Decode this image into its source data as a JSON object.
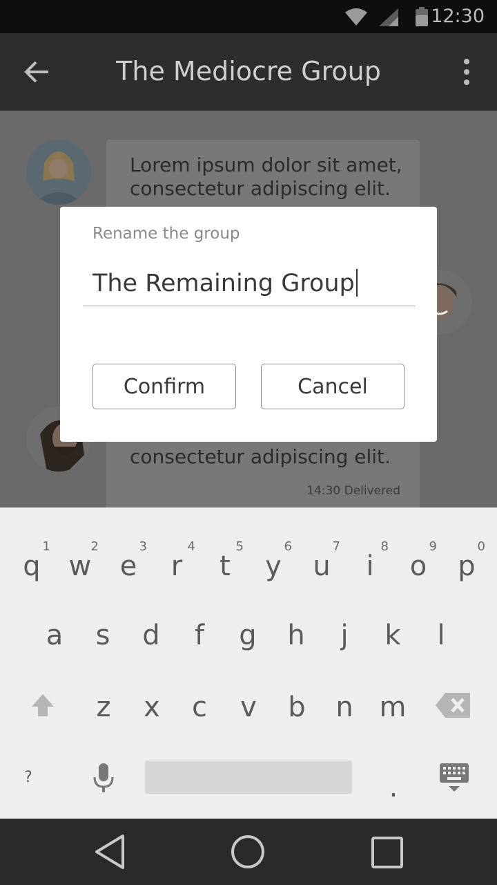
{
  "status_bar": {
    "time": "12:30"
  },
  "app_bar": {
    "title": "The Mediocre Group"
  },
  "chat": {
    "messages": [
      {
        "text": "Lorem ipsum dolor sit amet, consectetur adipiscing elit."
      },
      {
        "text": "consectetur adipiscing elit.",
        "meta": "14:30 Delivered"
      }
    ]
  },
  "dialog": {
    "label": "Rename the group",
    "input_value": "The Remaining Group",
    "confirm_label": "Confirm",
    "cancel_label": "Cancel"
  },
  "keyboard": {
    "row1": [
      {
        "ch": "q",
        "hint": "1"
      },
      {
        "ch": "w",
        "hint": "2"
      },
      {
        "ch": "e",
        "hint": "3"
      },
      {
        "ch": "r",
        "hint": "4"
      },
      {
        "ch": "t",
        "hint": "5"
      },
      {
        "ch": "y",
        "hint": "6"
      },
      {
        "ch": "u",
        "hint": "7"
      },
      {
        "ch": "i",
        "hint": "8"
      },
      {
        "ch": "o",
        "hint": "9"
      },
      {
        "ch": "p",
        "hint": "0"
      }
    ],
    "row2": [
      "a",
      "s",
      "d",
      "f",
      "g",
      "h",
      "j",
      "k",
      "l"
    ],
    "row3": [
      "z",
      "x",
      "c",
      "v",
      "b",
      "n",
      "m"
    ],
    "symbols_key": "?",
    "period_key": "."
  },
  "colors": {
    "app_bar_bg": "#2d2d2d",
    "overlay_bg": "#6a6a6a",
    "dialog_bg": "#ffffff",
    "keyboard_bg": "#eeeeee",
    "nav_bar_bg": "#2a2a2a"
  },
  "icons": [
    "wifi-icon",
    "signal-icon",
    "battery-icon",
    "back-arrow-icon",
    "more-vert-icon",
    "shift-icon",
    "backspace-icon",
    "microphone-icon",
    "keyboard-hide-icon",
    "nav-back-icon",
    "nav-home-icon",
    "nav-recents-icon"
  ]
}
